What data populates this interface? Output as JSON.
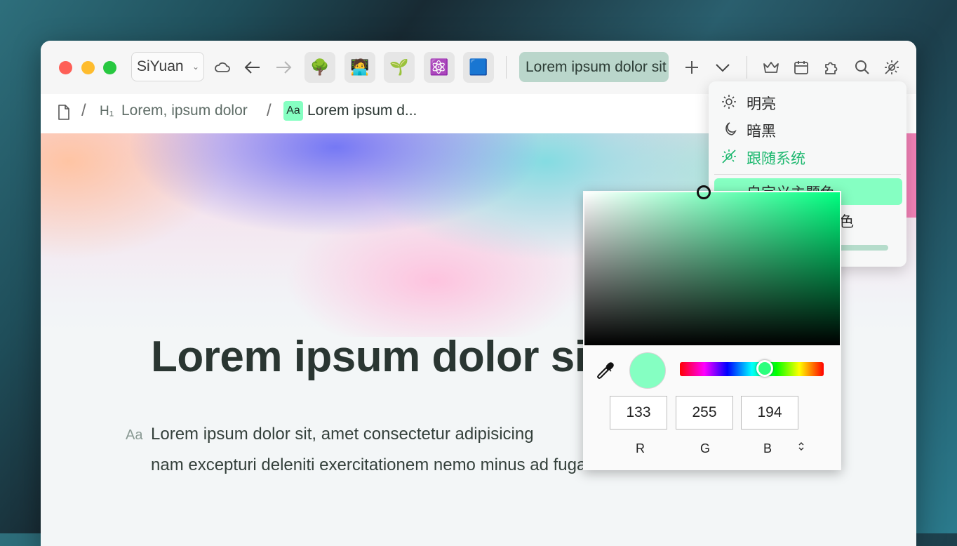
{
  "toolbar": {
    "workspace": "SiYuan",
    "dock_icons": [
      "🌳",
      "🧑‍💻",
      "🌱",
      "⚛️",
      "🟦"
    ],
    "active_tab": "Lorem ipsum dolor sit"
  },
  "breadcrumb": {
    "heading_marker": "H₁",
    "heading": "Lorem, ipsum dolor",
    "current": "Lorem ipsum d...",
    "current_badge": "Aa"
  },
  "document": {
    "title": "Lorem ipsum dolor sit",
    "paragraph_marker": "Aa",
    "paragraph_line1": "Lorem ipsum dolor sit, amet consectetur adipisicing",
    "paragraph_line2": "nam excepturi deleniti exercitationem nemo minus ad fuga."
  },
  "theme_menu": {
    "items": [
      {
        "label": "明亮",
        "icon": "sun-icon"
      },
      {
        "label": "暗黑",
        "icon": "moon-icon"
      },
      {
        "label": "跟随系统",
        "icon": "system-theme-icon"
      }
    ],
    "custom_color_label": "自定义主题色",
    "custom_color_label2": "色"
  },
  "color_picker": {
    "r": "133",
    "g": "255",
    "b": "194",
    "labels": {
      "r": "R",
      "g": "G",
      "b": "B"
    },
    "mode_toggle": "⌃⌄",
    "current_color": "#85ffc2",
    "hue_color": "#00ff80"
  },
  "colors": {
    "accent": "#1db86f",
    "tab_bg": "#bad6cb",
    "menu_highlight": "#85ffc2"
  }
}
